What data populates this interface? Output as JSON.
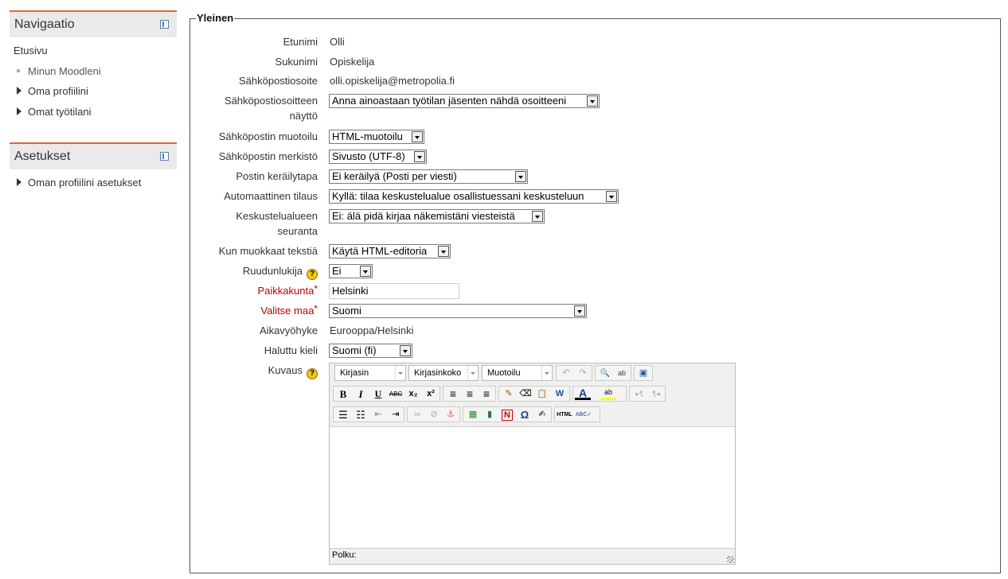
{
  "nav_block": {
    "title": "Navigaatio",
    "items": [
      {
        "label": "Etusivu"
      },
      {
        "label": "Minun Moodleni"
      },
      {
        "label": "Oma profiilini"
      },
      {
        "label": "Omat työtilani"
      }
    ]
  },
  "settings_block": {
    "title": "Asetukset",
    "items": [
      {
        "label": "Oman profiilini asetukset"
      }
    ]
  },
  "form": {
    "legend": "Yleinen",
    "firstname": {
      "label": "Etunimi",
      "value": "Olli"
    },
    "lastname": {
      "label": "Sukunimi",
      "value": "Opiskelija"
    },
    "email": {
      "label": "Sähköpostiosoite",
      "value": "olli.opiskelija@metropolia.fi"
    },
    "maildisplay": {
      "label_line1": "Sähköpostiosoitteen",
      "label_line2": "näyttö",
      "value": "Anna ainoastaan työtilan jäsenten nähdä osoitteeni"
    },
    "mailformat": {
      "label": "Sähköpostin muotoilu",
      "value": "HTML-muotoilu"
    },
    "mailcharset": {
      "label": "Sähköpostin merkistö",
      "value": "Sivusto (UTF-8)"
    },
    "maildigest": {
      "label": "Postin keräilytapa",
      "value": "Ei keräilyä (Posti per viesti)"
    },
    "autosubscribe": {
      "label": "Automaattinen tilaus",
      "value": "Kyllä: tilaa keskustelualue osallistuessani keskusteluun"
    },
    "trackforums": {
      "label_line1": "Keskustelualueen",
      "label_line2": "seuranta",
      "value": "Ei: älä pidä kirjaa näkemistäni viesteistä"
    },
    "htmleditor": {
      "label": "Kun muokkaat tekstiä",
      "value": "Käytä HTML-editoria"
    },
    "screenreader": {
      "label": "Ruudunlukija",
      "value": "Ei"
    },
    "city": {
      "label": "Paikkakunta",
      "value": "Helsinki"
    },
    "country": {
      "label": "Valitse maa",
      "value": "Suomi"
    },
    "timezone": {
      "label": "Aikavyöhyke",
      "value": "Eurooppa/Helsinki"
    },
    "lang": {
      "label": "Haluttu kieli",
      "value": "Suomi (fi)"
    },
    "description": {
      "label": "Kuvaus"
    },
    "required_marker": "*",
    "help_glyph": "?"
  },
  "editor": {
    "font_family": "Kirjasin",
    "font_size": "Kirjasinkoko",
    "format": "Muotoilu",
    "status_path": "Polku:",
    "buttons": {
      "undo": "↶",
      "redo": "↷",
      "find": "🔍",
      "replace": "ab",
      "fullscreen": "▣",
      "bold": "B",
      "italic": "I",
      "underline": "U",
      "strike": "ABC",
      "subscript": "x₂",
      "superscript": "x²",
      "justify_left": "≡",
      "justify_center": "≡",
      "justify_right": "≡",
      "clean": "✎",
      "remove_format": "⌫",
      "paste_text": "📋",
      "paste_word": "W",
      "forecolor": "A",
      "backcolor": "ab",
      "ltr": "▸¶",
      "rtl": "¶◂",
      "bullist": "☰",
      "numlist": "☷",
      "outdent": "⇤",
      "indent": "⇥",
      "link": "∞",
      "unlink": "⊘",
      "anchor": "⚓",
      "image": "▦",
      "media": "▮",
      "nolink": "N",
      "charmap": "Ω",
      "edit": "✍",
      "html": "HTML",
      "spell": "ABC✓"
    }
  },
  "colors": {
    "accent": "#dd6633",
    "required": "#b9000a",
    "block_bg": "#eaeaea"
  }
}
